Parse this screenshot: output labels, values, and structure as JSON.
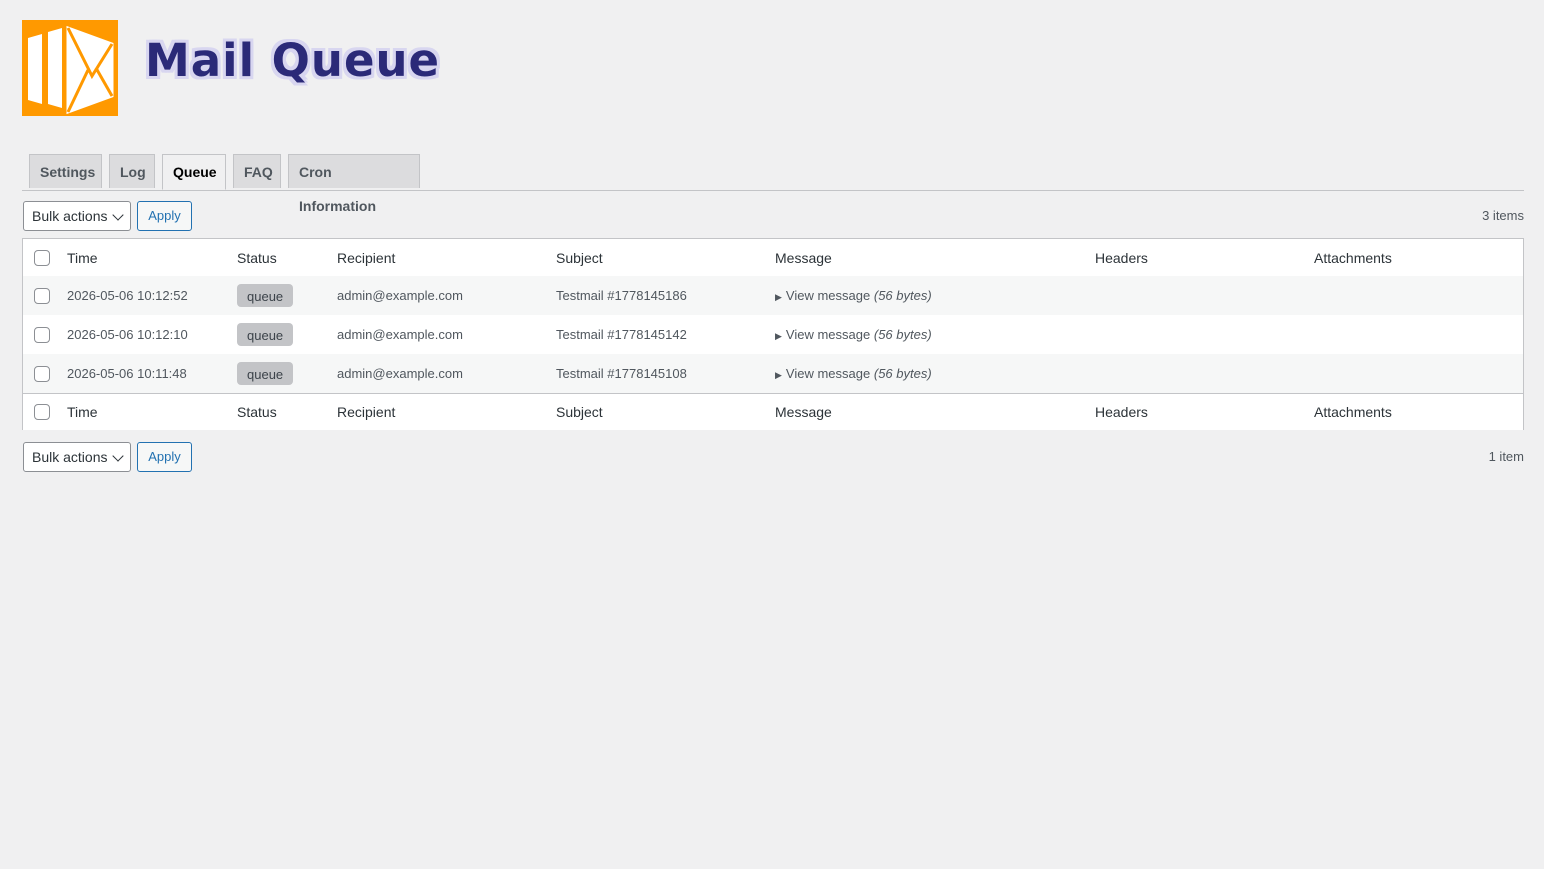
{
  "header": {
    "title": "Mail Queue",
    "logo_icon": "mail-queue-logo-icon",
    "accent": "#ff9900"
  },
  "tabs": [
    {
      "label": "Settings",
      "active": false
    },
    {
      "label": "Log",
      "active": false
    },
    {
      "label": "Queue",
      "active": true
    },
    {
      "label": "FAQ",
      "active": false
    },
    {
      "label": "Cron Information",
      "active": false
    }
  ],
  "bulk_top": {
    "select_value": "Bulk actions",
    "apply_label": "Apply",
    "count": "3 items"
  },
  "bulk_bottom": {
    "select_value": "Bulk actions",
    "apply_label": "Apply",
    "count": "1 item"
  },
  "table": {
    "columns": [
      "Time",
      "Status",
      "Recipient",
      "Subject",
      "Message",
      "Headers",
      "Attachments"
    ],
    "rows": [
      {
        "time": "2026-05-06 10:12:52",
        "status": "queue",
        "recipient": "admin@example.com",
        "subject": "Testmail #1778145186",
        "message_link": "View message",
        "message_size": "(56 bytes)"
      },
      {
        "time": "2026-05-06 10:12:10",
        "status": "queue",
        "recipient": "admin@example.com",
        "subject": "Testmail #1778145142",
        "message_link": "View message",
        "message_size": "(56 bytes)"
      },
      {
        "time": "2026-05-06 10:11:48",
        "status": "queue",
        "recipient": "admin@example.com",
        "subject": "Testmail #1778145108",
        "message_link": "View message",
        "message_size": "(56 bytes)"
      }
    ]
  }
}
